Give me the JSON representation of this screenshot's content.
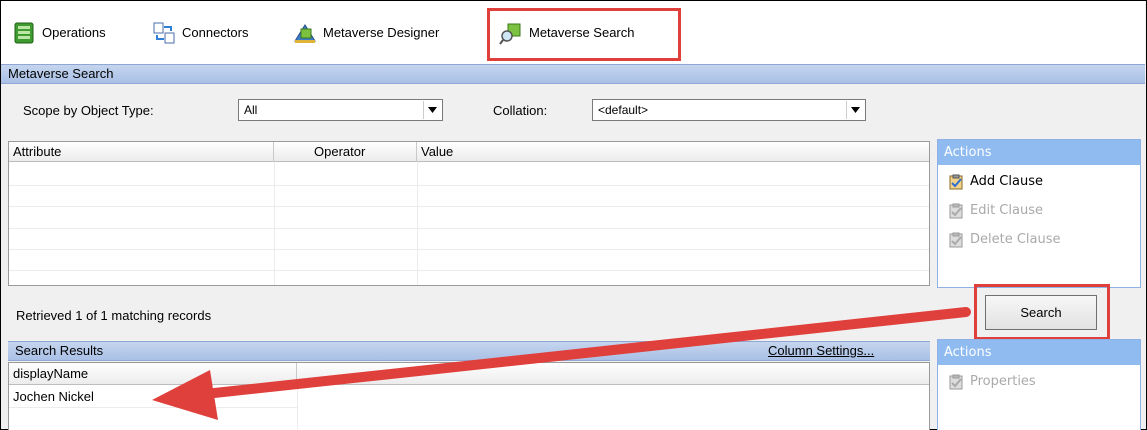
{
  "toolbar": {
    "items": [
      {
        "label": "Operations",
        "icon": "operations-icon"
      },
      {
        "label": "Connectors",
        "icon": "connectors-icon"
      },
      {
        "label": "Metaverse Designer",
        "icon": "metaverse-designer-icon"
      },
      {
        "label": "Metaverse Search",
        "icon": "metaverse-search-icon"
      }
    ],
    "highlight_color": "#e0403c"
  },
  "search_panel": {
    "title": "Metaverse Search",
    "scope_label": "Scope by Object Type:",
    "scope_value": "All",
    "collation_label": "Collation:",
    "collation_value": "<default>"
  },
  "clause_grid": {
    "columns": [
      "Attribute",
      "Operator",
      "Value"
    ],
    "rows": []
  },
  "clause_actions": {
    "title": "Actions",
    "items": [
      {
        "label": "Add Clause",
        "enabled": true
      },
      {
        "label": "Edit Clause",
        "enabled": false
      },
      {
        "label": "Delete Clause",
        "enabled": false
      }
    ]
  },
  "status": {
    "retrieved_text": "Retrieved 1 of 1 matching records"
  },
  "search_button": {
    "label": "Search"
  },
  "results": {
    "title": "Search Results",
    "column_settings_link": "Column Settings...",
    "columns": [
      "displayName"
    ],
    "rows": [
      [
        "Jochen Nickel"
      ]
    ]
  },
  "result_actions": {
    "title": "Actions",
    "items": [
      {
        "label": "Properties",
        "enabled": false
      }
    ]
  },
  "colors": {
    "section_bar": "#b7cbea",
    "actions_header": "#8fbbf0",
    "arrow": "#e0403c"
  }
}
